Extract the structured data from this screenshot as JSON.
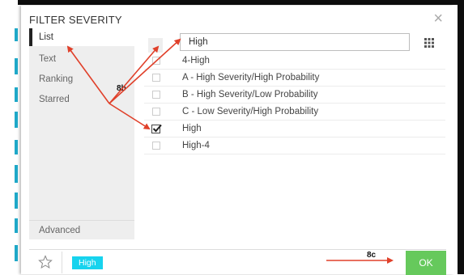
{
  "dialog": {
    "title": "FILTER SEVERITY",
    "close_glyph": "×"
  },
  "sidebar": {
    "items": [
      {
        "label": "List",
        "active": true
      },
      {
        "label": "Text",
        "active": false
      },
      {
        "label": "Ranking",
        "active": false
      },
      {
        "label": "Starred",
        "active": false
      }
    ],
    "advanced_label": "Advanced"
  },
  "search": {
    "value": "High",
    "grid_icon": "grid-icon"
  },
  "options": [
    {
      "label": "4-High",
      "checked": false
    },
    {
      "label": "A - High Severity/High Probability",
      "checked": false
    },
    {
      "label": "B - High Severity/Low Probability",
      "checked": false
    },
    {
      "label": "C - Low Severity/High Probability",
      "checked": false
    },
    {
      "label": "High",
      "checked": true
    },
    {
      "label": "High-4",
      "checked": false
    }
  ],
  "footer": {
    "star_icon": "star-icon",
    "selected_tag": "High",
    "ok_label": "OK"
  },
  "annotations": {
    "label_8b": "8b",
    "label_8c": "8c",
    "arrow_color": "#e0402a"
  },
  "colors": {
    "tag": "#17d3ee",
    "ok": "#66c95c",
    "side_marks": "#1fa8c8"
  }
}
